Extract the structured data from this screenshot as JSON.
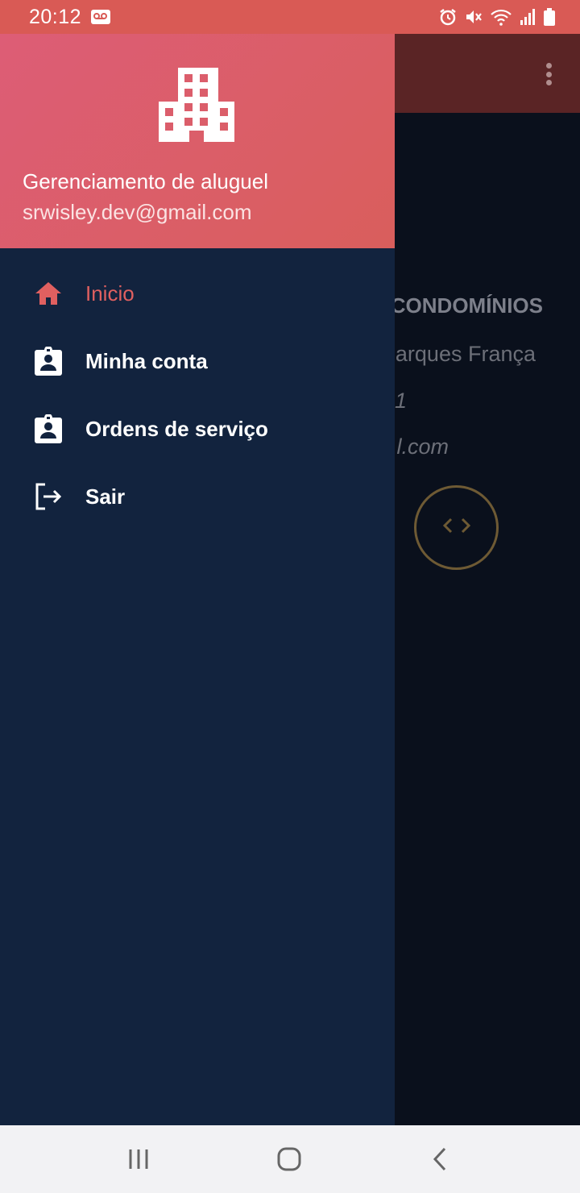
{
  "status_bar": {
    "time": "20:12",
    "left_icons": [
      "voicemail-icon"
    ],
    "right_icons": [
      "alarm-icon",
      "mute-icon",
      "wifi-icon",
      "signal-icon",
      "battery-icon"
    ],
    "background_color": "#d95a55"
  },
  "background_screen": {
    "toolbar_color": "#5a2425",
    "overflow_icon": "more-vert-icon",
    "title_partial": "CONDOMÍNIOS",
    "line1_partial": "arques França",
    "line2_partial": "1",
    "line3_partial": "l.com",
    "code_icon": "code-icon"
  },
  "drawer": {
    "header_icon": "building-icon",
    "app_name": "Gerenciamento de aluguel",
    "email": "srwisley.dev@gmail.com",
    "header_color": "#dd5d6a",
    "background_color": "#12233e",
    "accent_color": "#e06060",
    "menu_items": [
      {
        "label": "Inicio",
        "icon": "home-icon",
        "active": true
      },
      {
        "label": "Minha conta",
        "icon": "contact-badge-icon",
        "active": false
      },
      {
        "label": "Ordens de serviço",
        "icon": "contact-badge-icon",
        "active": false
      },
      {
        "label": "Sair",
        "icon": "logout-icon",
        "active": false
      }
    ]
  },
  "nav_bar": {
    "buttons": [
      "recent-apps-icon",
      "home-button-icon",
      "back-icon"
    ]
  }
}
